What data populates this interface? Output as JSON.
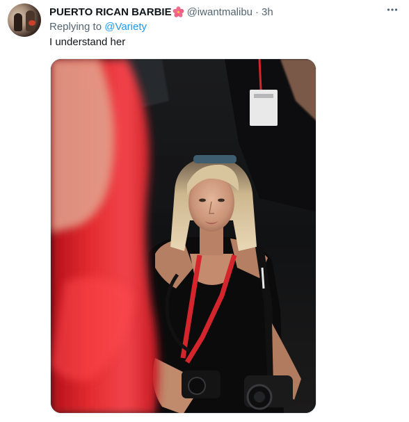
{
  "tweet": {
    "display_name": "PUERTO RICAN BARBIE",
    "name_emoji_icon": "hibiscus-icon",
    "handle": "@iwantmalibu",
    "separator": "·",
    "time": "3h",
    "reply_prefix": "Replying to",
    "reply_mention": "@Variety",
    "text": "I understand her",
    "more_icon": "more-icon"
  },
  "colors": {
    "text_primary": "#0f1419",
    "text_secondary": "#536471",
    "link": "#1d9bf0",
    "red_lanyard": "#d4252c"
  }
}
